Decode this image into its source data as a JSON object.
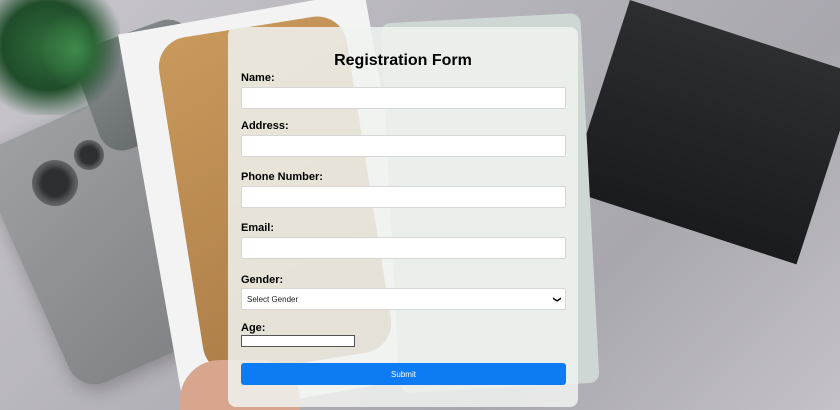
{
  "form": {
    "title": "Registration Form",
    "fields": {
      "name": {
        "label": "Name:",
        "value": ""
      },
      "address": {
        "label": "Address:",
        "value": ""
      },
      "phone": {
        "label": "Phone Number:",
        "value": ""
      },
      "email": {
        "label": "Email:",
        "value": ""
      },
      "gender": {
        "label": "Gender:",
        "selected": "Select Gender"
      },
      "age": {
        "label": "Age:",
        "value": ""
      }
    },
    "submit_label": "Submit"
  },
  "colors": {
    "submit_bg": "#0d7cf4",
    "card_bg": "rgba(240,242,240,0.86)"
  }
}
